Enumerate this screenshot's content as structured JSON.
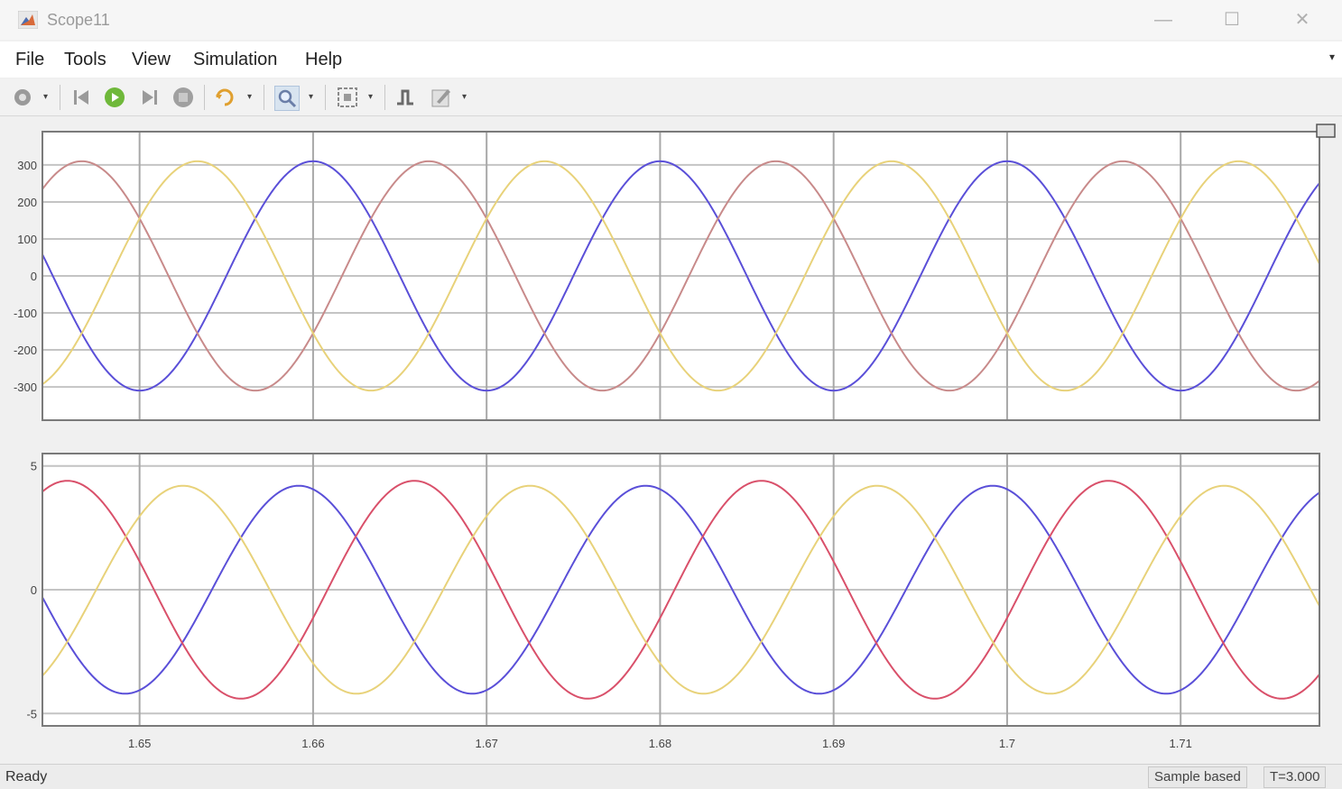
{
  "window": {
    "title": "Scope11"
  },
  "menu": [
    "File",
    "Tools",
    "View",
    "Simulation",
    "Help"
  ],
  "status": {
    "text": "Ready",
    "mode": "Sample based",
    "time": "T=3.000"
  },
  "chart_data": [
    {
      "type": "line",
      "title": "",
      "xlabel": "",
      "ylabel": "",
      "xlim": [
        1.6444,
        1.718
      ],
      "ylim": [
        -390,
        390
      ],
      "yticks": [
        -300,
        -200,
        -100,
        0,
        100,
        200,
        300
      ],
      "ytick_labels": [
        "-300",
        "-200",
        "-100",
        "0",
        "100",
        "200",
        "300"
      ],
      "xticks": [
        1.65,
        1.66,
        1.67,
        1.68,
        1.69,
        1.7,
        1.71
      ],
      "xtick_labels": [],
      "grid": true,
      "waveform": {
        "frequency_hz": 50,
        "amplitude": 310
      },
      "series": [
        {
          "color": "#5a4fd8",
          "amplitude": 310,
          "phase_deg": 90
        },
        {
          "color": "#c88a8a",
          "amplitude": 310,
          "phase_deg": -30
        },
        {
          "color": "#e8d27a",
          "amplitude": 310,
          "phase_deg": 210
        }
      ]
    },
    {
      "type": "line",
      "title": "",
      "xlabel": "",
      "ylabel": "",
      "xlim": [
        1.6444,
        1.718
      ],
      "ylim": [
        -5.5,
        5.5
      ],
      "yticks": [
        -5,
        0,
        5
      ],
      "ytick_labels": [
        "-5",
        "0",
        "5"
      ],
      "xticks": [
        1.65,
        1.66,
        1.67,
        1.68,
        1.69,
        1.7,
        1.71
      ],
      "xtick_labels": [
        "1.65",
        "1.66",
        "1.67",
        "1.68",
        "1.69",
        "1.7",
        "1.71"
      ],
      "grid": true,
      "waveform": {
        "frequency_hz": 50
      },
      "series": [
        {
          "color": "#5a4fd8",
          "amplitude": 4.2,
          "phase_deg": 105
        },
        {
          "color": "#d9506a",
          "amplitude": 4.4,
          "phase_deg": -15
        },
        {
          "color": "#e8d27a",
          "amplitude": 4.2,
          "phase_deg": 225
        }
      ]
    }
  ]
}
